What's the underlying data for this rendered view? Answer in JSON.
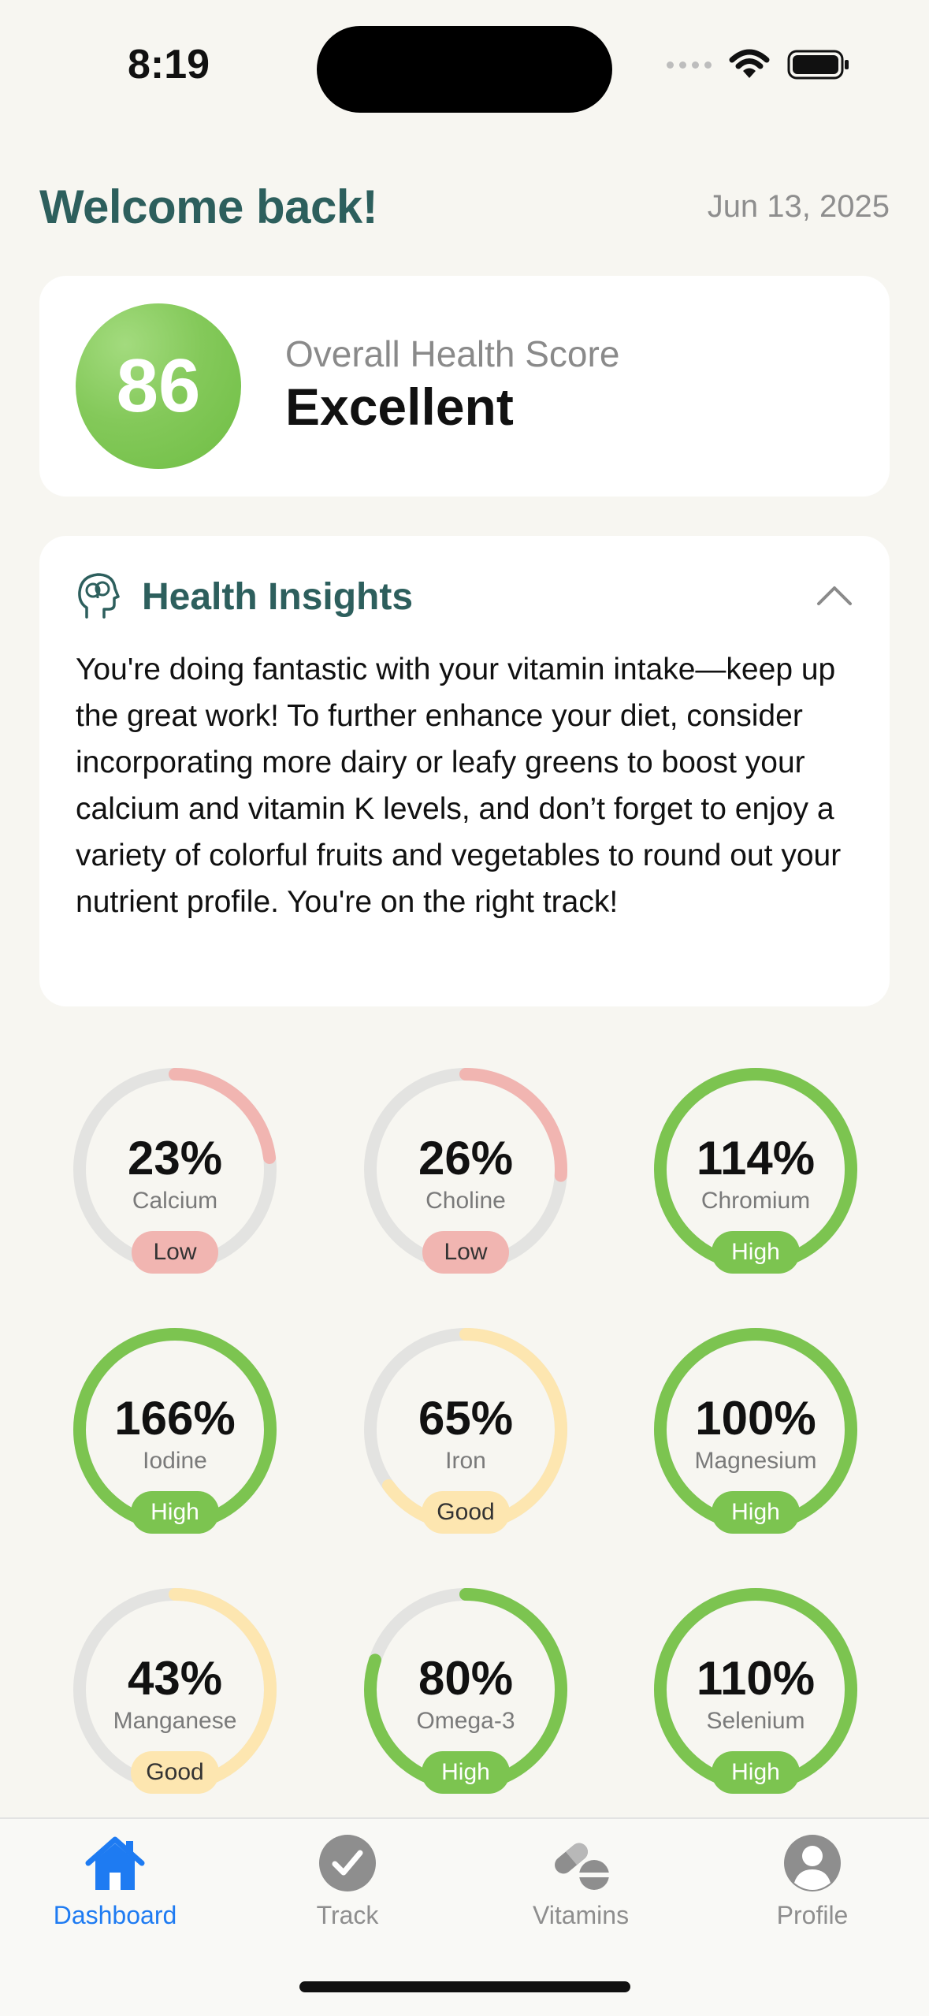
{
  "status": {
    "time": "8:19"
  },
  "header": {
    "welcome": "Welcome back!",
    "date": "Jun 13, 2025"
  },
  "score": {
    "value": "86",
    "label": "Overall Health Score",
    "rating": "Excellent",
    "color": "#7CC450"
  },
  "insights": {
    "title": "Health Insights",
    "icon": "brain-head-icon",
    "text": "You're doing fantastic with your vitamin intake—keep up the great work! To further enhance your diet, consider incorporating more dairy or leafy greens to boost your calcium and vitamin K levels, and don’t forget to enjoy a variety of colorful fruits and vegetables to round out your nutrient profile. You're on the right track!"
  },
  "colors": {
    "low": "#F1B5B1",
    "good": "#FDE6B0",
    "high": "#7CC450",
    "track": "#E3E3E1",
    "accent": "#1E7BF2",
    "title": "#2D5F5D"
  },
  "nutrients": [
    {
      "pct": "23%",
      "name": "Calcium",
      "status": "Low",
      "value": 0.23
    },
    {
      "pct": "26%",
      "name": "Choline",
      "status": "Low",
      "value": 0.26
    },
    {
      "pct": "114%",
      "name": "Chromium",
      "status": "High",
      "value": 1.14
    },
    {
      "pct": "166%",
      "name": "Iodine",
      "status": "High",
      "value": 1.66
    },
    {
      "pct": "65%",
      "name": "Iron",
      "status": "Good",
      "value": 0.65
    },
    {
      "pct": "100%",
      "name": "Magnesium",
      "status": "High",
      "value": 1.0
    },
    {
      "pct": "43%",
      "name": "Manganese",
      "status": "Good",
      "value": 0.43
    },
    {
      "pct": "80%",
      "name": "Omega-3",
      "status": "High",
      "value": 0.8
    },
    {
      "pct": "110%",
      "name": "Selenium",
      "status": "High",
      "value": 1.1
    }
  ],
  "tabs": [
    {
      "label": "Dashboard",
      "icon": "house-icon",
      "active": true
    },
    {
      "label": "Track",
      "icon": "checkmark-circle-icon",
      "active": false
    },
    {
      "label": "Vitamins",
      "icon": "pills-icon",
      "active": false
    },
    {
      "label": "Profile",
      "icon": "person-circle-icon",
      "active": false
    }
  ]
}
